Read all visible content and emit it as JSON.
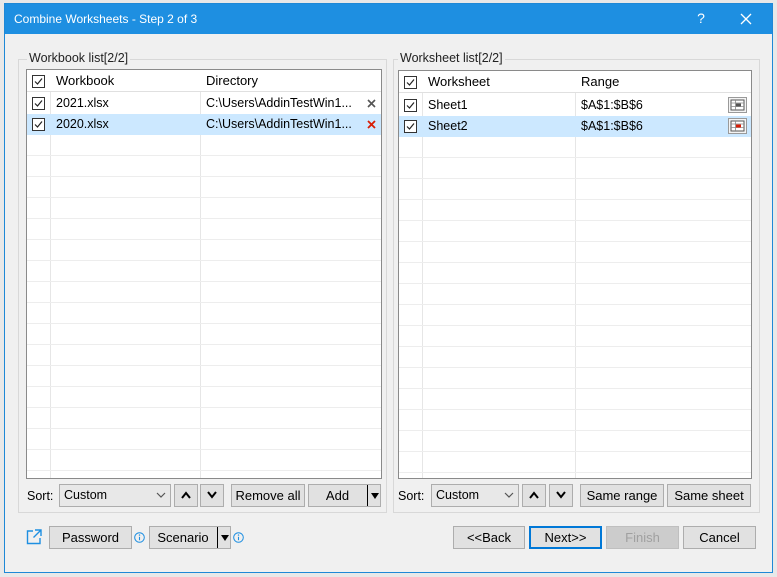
{
  "window": {
    "title": "Combine Worksheets - Step 2 of 3",
    "help_label": "?"
  },
  "workbook_panel": {
    "title": "Workbook list[2/2]",
    "columns": [
      "Workbook",
      "Directory"
    ],
    "rows": [
      {
        "name": "2021.xlsx",
        "directory": "C:\\Users\\AddinTestWin1...",
        "checked": true,
        "remove_color": "#555555"
      },
      {
        "name": "2020.xlsx",
        "directory": "C:\\Users\\AddinTestWin1...",
        "checked": true,
        "selected": true,
        "remove_color": "#d81e06"
      }
    ],
    "sort_label": "Sort:",
    "sort_value": "Custom",
    "remove_all_label": "Remove all",
    "add_label": "Add"
  },
  "worksheet_panel": {
    "title": "Worksheet list[2/2]",
    "columns": [
      "Worksheet",
      "Range"
    ],
    "rows": [
      {
        "name": "Sheet1",
        "range": "$A$1:$B$6",
        "checked": true
      },
      {
        "name": "Sheet2",
        "range": "$A$1:$B$6",
        "checked": true,
        "selected": true
      }
    ],
    "sort_label": "Sort:",
    "sort_value": "Custom",
    "same_range_label": "Same range",
    "same_sheet_label": "Same sheet"
  },
  "footer": {
    "password_label": "Password",
    "scenario_label": "Scenario",
    "back_label": "<<Back",
    "next_label": "Next>>",
    "finish_label": "Finish",
    "cancel_label": "Cancel"
  },
  "colors": {
    "titlebar": "#1e8fe1",
    "selection": "#cce8ff",
    "accent": "#0078d7"
  }
}
